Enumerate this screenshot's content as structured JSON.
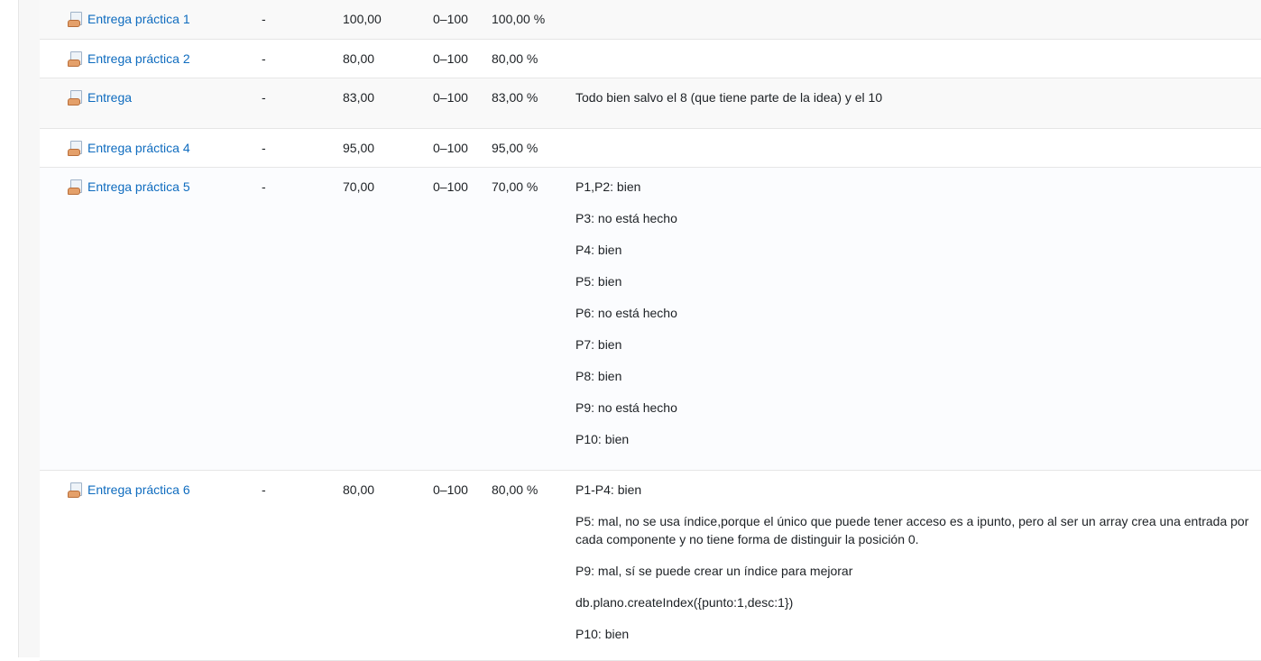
{
  "rows": [
    {
      "item": "Entrega práctica 1",
      "weight": "-",
      "grade": "100,00",
      "range": "0–100",
      "percentage": "100,00 %",
      "feedback": []
    },
    {
      "item": "Entrega práctica 2",
      "weight": "-",
      "grade": "80,00",
      "range": "0–100",
      "percentage": "80,00 %",
      "feedback": []
    },
    {
      "item": "Entrega",
      "weight": "-",
      "grade": "83,00",
      "range": "0–100",
      "percentage": "83,00 %",
      "feedback": [
        "Todo bien salvo el 8 (que tiene parte de la idea) y el 10"
      ]
    },
    {
      "item": "Entrega práctica 4",
      "weight": "-",
      "grade": "95,00",
      "range": "0–100",
      "percentage": "95,00 %",
      "feedback": []
    },
    {
      "item": "Entrega práctica 5",
      "weight": "-",
      "grade": "70,00",
      "range": "0–100",
      "percentage": "70,00 %",
      "feedback": [
        "P1,P2: bien",
        "P3: no está hecho",
        "P4: bien",
        "P5: bien",
        "P6: no está hecho",
        "P7: bien",
        "P8: bien",
        "P9: no está hecho",
        "P10: bien"
      ]
    },
    {
      "item": "Entrega práctica 6",
      "weight": "-",
      "grade": "80,00",
      "range": "0–100",
      "percentage": "80,00 %",
      "feedback": [
        "P1-P4: bien",
        "P5: mal, no se usa índice,porque el único que puede tener acceso es a ipunto, pero al ser un array crea una entrada por cada componente y no tiene forma de distinguir la posición 0.",
        "P9: mal, sí se puede crear un índice para mejorar",
        "db.plano.createIndex({punto:1,desc:1})",
        "P10: bien"
      ]
    }
  ],
  "icon": "assignment-icon",
  "colors": {
    "link": "#0f6cbf",
    "text": "#1d2125",
    "row_alt": "#f9f9f9",
    "border": "#e6e6e6"
  }
}
